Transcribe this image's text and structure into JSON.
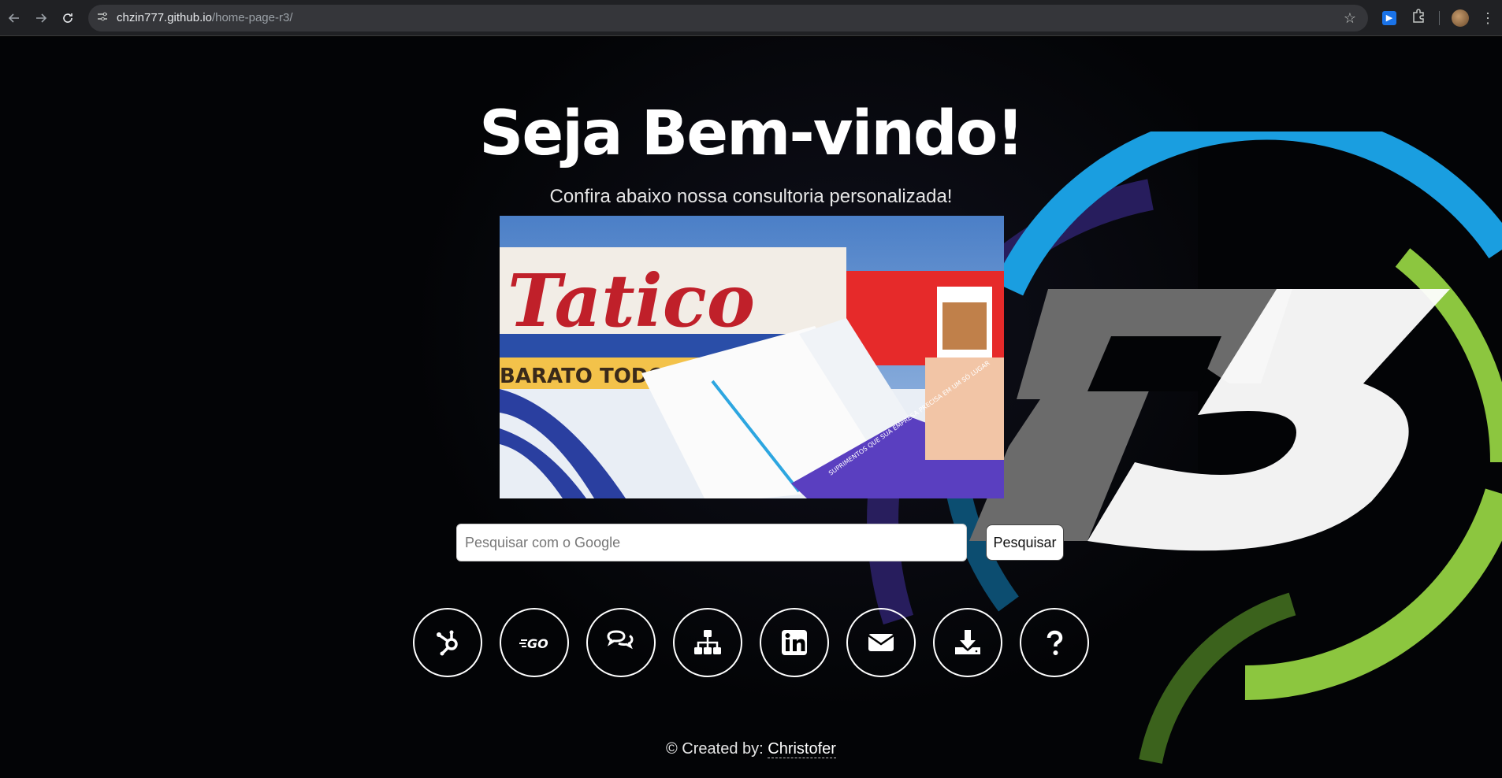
{
  "browser": {
    "url_host": "chzin777.github.io",
    "url_path": "/home-page-r3/"
  },
  "hero": {
    "title": "Seja Bem-vindo!",
    "subtitle": "Confira abaixo nossa consultoria personalizada!"
  },
  "photo": {
    "sign_text": "Tatico",
    "banner_text": "BARATO TODO DIA",
    "brochure_text": "SUPRIMENTOS QUE SUA EMPRESA PRECISA EM UM SÓ LUGAR"
  },
  "search": {
    "placeholder": "Pesquisar com o Google",
    "button_label": "Pesquisar"
  },
  "links": [
    {
      "icon": "hubspot-icon"
    },
    {
      "icon": "go-icon"
    },
    {
      "icon": "chat-icon"
    },
    {
      "icon": "sitemap-icon"
    },
    {
      "icon": "linkedin-icon"
    },
    {
      "icon": "mail-icon"
    },
    {
      "icon": "download-icon"
    },
    {
      "icon": "help-icon"
    }
  ],
  "footer": {
    "prefix": "© Created by: ",
    "author": "Christofer"
  },
  "logo": {
    "text": "R3",
    "colors": {
      "blue": "#1a9ee0",
      "green": "#8cc63f",
      "purple": "#3b2a7a",
      "grey": "#666666"
    }
  }
}
